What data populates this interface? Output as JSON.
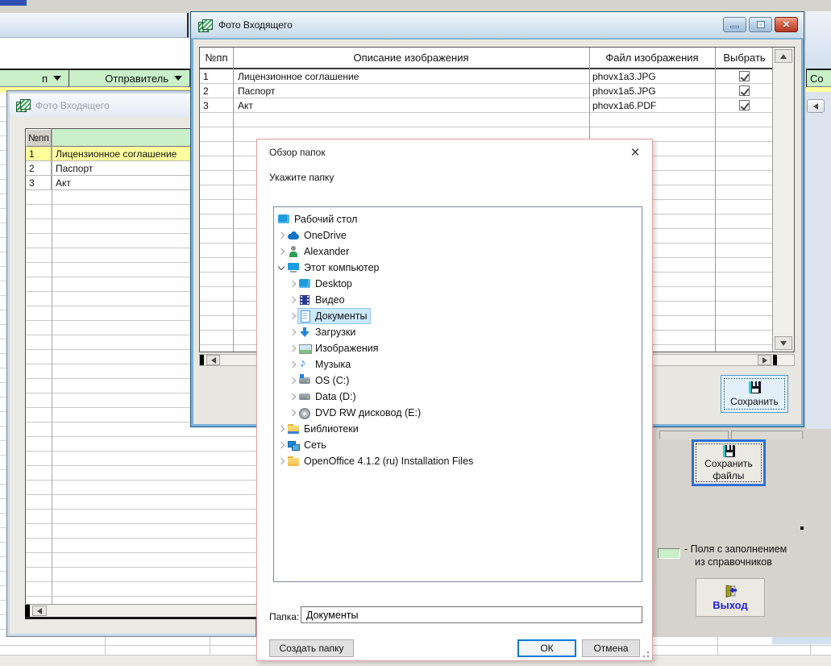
{
  "colors": {
    "header_green": "#c9f0c9",
    "selected_row_yellow": "#ffff9e",
    "tree_selection_blue": "#cce8ff",
    "close_button_red": "#c5402c",
    "accent_blue_border": "#2f6fd6"
  },
  "icons": {
    "window_icon": "stacked-green-photos",
    "save_icon": "floppy-disk",
    "exit_icon": "open-door-with-blue-arrow",
    "close_icon": "x-cross",
    "filter_icon": "down-triangle"
  },
  "background_window": {
    "header_left": {
      "col1": "п",
      "col2": "Отправитель"
    },
    "header_right": "Со",
    "save_files_button": {
      "line1": "Сохранить",
      "line2": "файлы"
    },
    "legend": {
      "line1": "- Поля с заполнением",
      "line2": "из справочников"
    },
    "exit_button": {
      "label": "Выход"
    }
  },
  "back_photo_window": {
    "title": "Фото Входящего",
    "num_header": "№пп",
    "rows": [
      {
        "num": "1",
        "desc": "Лицензионное соглашение"
      },
      {
        "num": "2",
        "desc": "Паспорт"
      },
      {
        "num": "3",
        "desc": "Акт"
      }
    ]
  },
  "front_photo_window": {
    "title": "Фото Входящего",
    "columns": {
      "num": "№пп",
      "desc": "Описание изображения",
      "file": "Файл изображения",
      "select": "Выбрать"
    },
    "rows": [
      {
        "num": "1",
        "desc": "Лицензионное соглашение",
        "file": "phovx1a3.JPG",
        "checked": true
      },
      {
        "num": "2",
        "desc": "Паспорт",
        "file": "phovx1a5.JPG",
        "checked": true
      },
      {
        "num": "3",
        "desc": "Акт",
        "file": "phovx1a6.PDF",
        "checked": true
      }
    ],
    "save_button": "Сохранить"
  },
  "browse_dialog": {
    "title": "Обзор папок",
    "prompt": "Укажите папку",
    "tree": [
      {
        "label": "Рабочий стол",
        "icon": "desktop-icon",
        "level": 0
      },
      {
        "label": "OneDrive",
        "icon": "onedrive-cloud-icon",
        "level": 1
      },
      {
        "label": "Alexander",
        "icon": "user-icon",
        "level": 1
      },
      {
        "label": "Этот компьютер",
        "icon": "computer-icon",
        "level": 1,
        "expanded": true
      },
      {
        "label": "Desktop",
        "icon": "desktop-icon",
        "level": 2
      },
      {
        "label": "Видео",
        "icon": "video-icon",
        "level": 2
      },
      {
        "label": "Документы",
        "icon": "documents-icon",
        "level": 2,
        "selected": true
      },
      {
        "label": "Загрузки",
        "icon": "downloads-icon",
        "level": 2
      },
      {
        "label": "Изображения",
        "icon": "pictures-icon",
        "level": 2
      },
      {
        "label": "Музыка",
        "icon": "music-icon",
        "level": 2
      },
      {
        "label": "OS (C:)",
        "icon": "os-drive-icon",
        "level": 2
      },
      {
        "label": "Data (D:)",
        "icon": "drive-icon",
        "level": 2
      },
      {
        "label": "DVD RW дисковод (E:)",
        "icon": "dvd-drive-icon",
        "level": 2
      },
      {
        "label": "Библиотеки",
        "icon": "libraries-icon",
        "level": 1
      },
      {
        "label": "Сеть",
        "icon": "network-icon",
        "level": 1
      },
      {
        "label": "OpenOffice 4.1.2 (ru) Installation Files",
        "icon": "folder-icon",
        "level": 1
      }
    ],
    "folder_label": "Папка:",
    "folder_value": "Документы",
    "create_folder_button": "Создать папку",
    "ok_button": "ОК",
    "cancel_button": "Отмена"
  }
}
